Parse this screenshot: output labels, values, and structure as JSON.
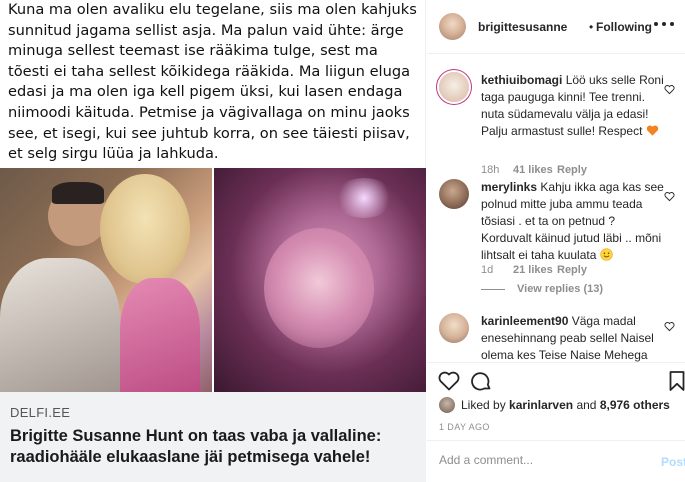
{
  "post": {
    "article_text": "Kuna ma olen avaliku elu tegelane, siis ma olen kahjuks sunnitud jagama sellist asja. Ma palun vaid ühte: ärge minuga sellest teemast ise rääkima tulge, sest ma tõesti ei taha sellest kõikidega rääkida. Ma liigun eluga edasi ja ma olen iga kell pigem üksi, kui lasen endaga niimoodi käituda. Petmise ja vägivallaga on minu jaoks see, et isegi, kui see juhtub korra, on see täiesti piisav, et selg sirgu lüüa ja lahkuda.",
    "source": "DELFI.EE",
    "headline": "Brigitte Susanne Hunt on taas vaba ja vallaline: raadiohääle elukaaslane jäi petmisega vahele!"
  },
  "header": {
    "username": "brigittesusanne",
    "separator": "•",
    "follow_status": "Following",
    "more_icon": "more-horizontal-icon"
  },
  "comments": [
    {
      "username": "kethiuibomagi",
      "text": "Löö uks selle Roni taga pauguga kinni! Tee trenni. nuta südamevalu välja ja edasi! Palju armastust sulle! Respect",
      "emoji": "orange-heart",
      "age": "18h",
      "likes": "41 likes",
      "reply": "Reply"
    },
    {
      "username": "merylinks",
      "text": "Kahju ikka aga kas see polnud mitte juba ammu teada tõsiasi . et ta on petnud ? Korduvalt käinud jutud läbi .. mõni lihtsalt ei taha kuulata",
      "emoji": "smiling-face",
      "age": "1d",
      "likes": "21 likes",
      "reply": "Reply",
      "view_replies": "View replies (13)"
    },
    {
      "username": "karinleement90",
      "text": "Väga madal enesehinnang peab sellel Naisel olema kes Teise Naise Mehega"
    }
  ],
  "liked_by": {
    "prefix": "Liked by",
    "user": "karinlarven",
    "conjunction": "and",
    "others": "8,976 others"
  },
  "post_age": "1 DAY AGO",
  "comment_box": {
    "placeholder": "Add a comment...",
    "post_label": "Post"
  },
  "colors": {
    "link_blue_disabled": "#b3dbff",
    "muted_text": "#8e8e8e",
    "primary_text": "#262626",
    "border": "#efefef"
  }
}
